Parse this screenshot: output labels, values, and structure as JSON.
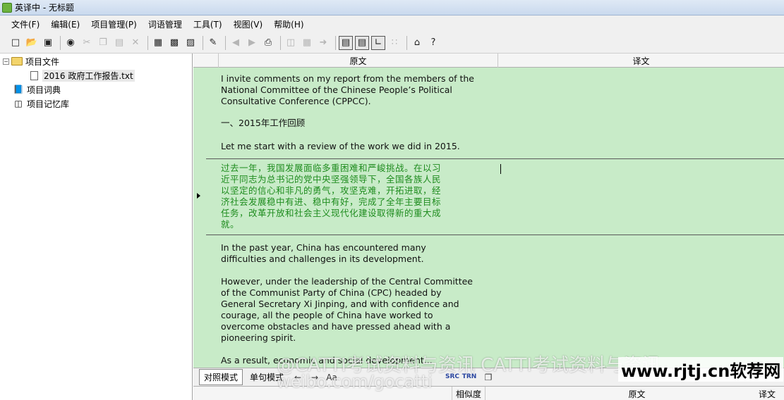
{
  "window": {
    "title": "英译中 - 无标题"
  },
  "menu": [
    "文件(F)",
    "编辑(E)",
    "项目管理(P)",
    "词语管理",
    "工具(T)",
    "视图(V)",
    "帮助(H)"
  ],
  "toolbar_icons": [
    "new-file-icon",
    "open-folder-icon",
    "save-icon",
    "find-icon",
    "cut-icon",
    "copy-icon",
    "paste-icon",
    "delete-icon",
    "gear-icon",
    "help-icon"
  ],
  "tree": {
    "project_files": "项目文件",
    "file_name": "2016 政府工作报告.txt",
    "project_dictionary": "项目词典",
    "project_memory": "项目记忆库"
  },
  "grid": {
    "source_header": "原文",
    "target_header": "译文",
    "segments": [
      {
        "lines": [
          "I invite comments on my report from the members of the",
          "National Committee of the Chinese People’s Political",
          "Consultative Conference (CPPCC)."
        ]
      },
      {
        "lines": [
          "一、2015年工作回顾"
        ]
      },
      {
        "lines": [
          "Let me start with a review of the work we did in 2015."
        ]
      },
      {
        "lines": [
          "过去一年，我国发展面临多重困难和严峻挑战。在以习",
          "近平同志为总书记的党中央坚强领导下，全国各族人民",
          "以坚定的信心和非凡的勇气，攻坚克难，开拓进取，经",
          "济社会发展稳中有进、稳中有好，完成了全年主要目标",
          "任务，改革开放和社会主义现代化建设取得新的重大成",
          "就。"
        ]
      },
      {
        "lines": [
          "In the past year, China has encountered many",
          "difficulties and challenges in its development."
        ]
      },
      {
        "lines": [
          "However, under the leadership of the Central Committee",
          "of the Communist Party of China (CPC) headed by",
          "General Secretary Xi Jinping, and with confidence and",
          "courage, all the people of China have worked to",
          "overcome obstacles and have pressed ahead with a",
          "pioneering spirit."
        ]
      },
      {
        "lines": [
          "As a result, economic and social development..."
        ]
      }
    ]
  },
  "bottom_bar": {
    "tab_parallel": "对照模式",
    "tab_sentence": "单句模式",
    "src_label": "SRC",
    "trn_label": "TRN"
  },
  "bottom_header": {
    "similarity": "相似度",
    "source": "原文",
    "target": "译文"
  },
  "watermark": {
    "line1": "@CATTI考试资料与资讯  CATTI考试资料与资讯",
    "line2": "weibo.com/gocatti",
    "brand": "www.rjtj.cn软荐网"
  },
  "colors": {
    "grid_bg": "#c8ebc8",
    "chinese_text": "#1e8c1e"
  }
}
